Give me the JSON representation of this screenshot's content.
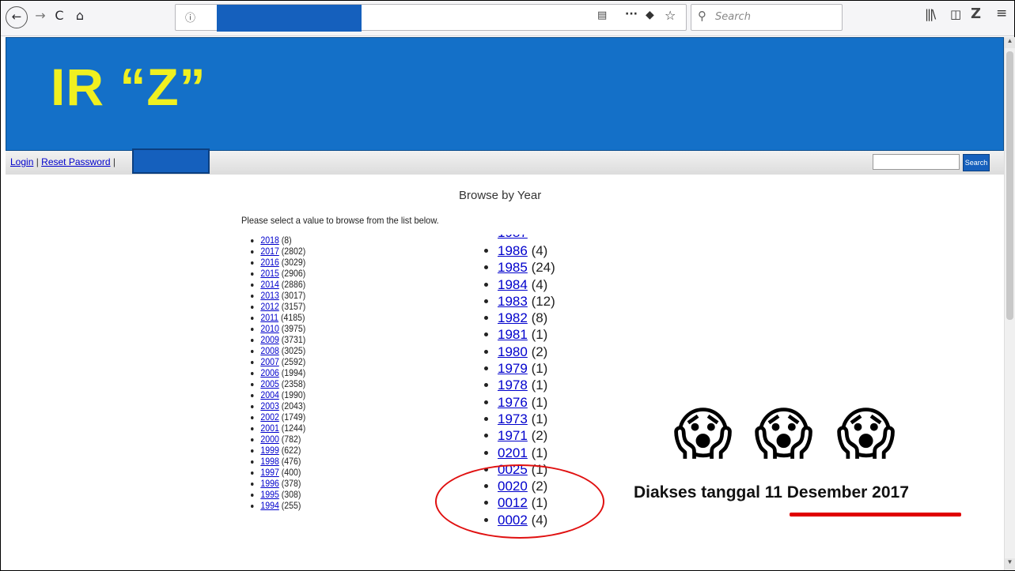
{
  "browser": {
    "back_icon": "←",
    "forward_icon": "→",
    "reload_icon": "C",
    "home_icon": "⌂",
    "url_info_icon": "ⓘ",
    "reader_icon": "▤",
    "more_icon": "···",
    "pocket_icon": "◆",
    "star_icon": "☆",
    "search_glass": "⚲",
    "search_placeholder": "Search",
    "library_icon": "|||\\",
    "sidebar_icon": "◫",
    "zotero_icon": "Z",
    "menu_icon": "≡"
  },
  "header": {
    "site_title": "IR “Z”"
  },
  "nav": {
    "login": "Login",
    "separator1": " | ",
    "reset_password": "Reset Password",
    "separator2": " |",
    "search_button": "Search"
  },
  "main": {
    "title": "Browse by Year",
    "instruction": "Please select a value to browse from the list below."
  },
  "years_left": [
    {
      "year": "2018",
      "count": "(8)"
    },
    {
      "year": "2017",
      "count": "(2802)"
    },
    {
      "year": "2016",
      "count": "(3029)"
    },
    {
      "year": "2015",
      "count": "(2906)"
    },
    {
      "year": "2014",
      "count": "(2886)"
    },
    {
      "year": "2013",
      "count": "(3017)"
    },
    {
      "year": "2012",
      "count": "(3157)"
    },
    {
      "year": "2011",
      "count": "(4185)"
    },
    {
      "year": "2010",
      "count": "(3975)"
    },
    {
      "year": "2009",
      "count": "(3731)"
    },
    {
      "year": "2008",
      "count": "(3025)"
    },
    {
      "year": "2007",
      "count": "(2592)"
    },
    {
      "year": "2006",
      "count": "(1994)"
    },
    {
      "year": "2005",
      "count": "(2358)"
    },
    {
      "year": "2004",
      "count": "(1990)"
    },
    {
      "year": "2003",
      "count": "(2043)"
    },
    {
      "year": "2002",
      "count": "(1749)"
    },
    {
      "year": "2001",
      "count": "(1244)"
    },
    {
      "year": "2000",
      "count": "(782)"
    },
    {
      "year": "1999",
      "count": "(622)"
    },
    {
      "year": "1998",
      "count": "(476)"
    },
    {
      "year": "1997",
      "count": "(400)"
    },
    {
      "year": "1996",
      "count": "(378)"
    },
    {
      "year": "1995",
      "count": "(308)"
    },
    {
      "year": "1994",
      "count": "(255)"
    }
  ],
  "years_right": [
    {
      "year": "1986",
      "count": "(4)"
    },
    {
      "year": "1985",
      "count": "(24)"
    },
    {
      "year": "1984",
      "count": "(4)"
    },
    {
      "year": "1983",
      "count": "(12)"
    },
    {
      "year": "1982",
      "count": "(8)"
    },
    {
      "year": "1981",
      "count": "(1)"
    },
    {
      "year": "1980",
      "count": "(2)"
    },
    {
      "year": "1979",
      "count": "(1)"
    },
    {
      "year": "1978",
      "count": "(1)"
    },
    {
      "year": "1976",
      "count": "(1)"
    },
    {
      "year": "1973",
      "count": "(1)"
    },
    {
      "year": "1971",
      "count": "(2)"
    },
    {
      "year": "0201",
      "count": "(1)"
    },
    {
      "year": "0025",
      "count": "(1)"
    },
    {
      "year": "0020",
      "count": "(2)"
    },
    {
      "year": "0012",
      "count": "(1)"
    },
    {
      "year": "0002",
      "count": "(4)"
    }
  ],
  "annotation": {
    "emoji": "😱",
    "prefix": "Diakses tanggal ",
    "date": "11 Desember 2017",
    "highlight_color": "#e00000"
  }
}
